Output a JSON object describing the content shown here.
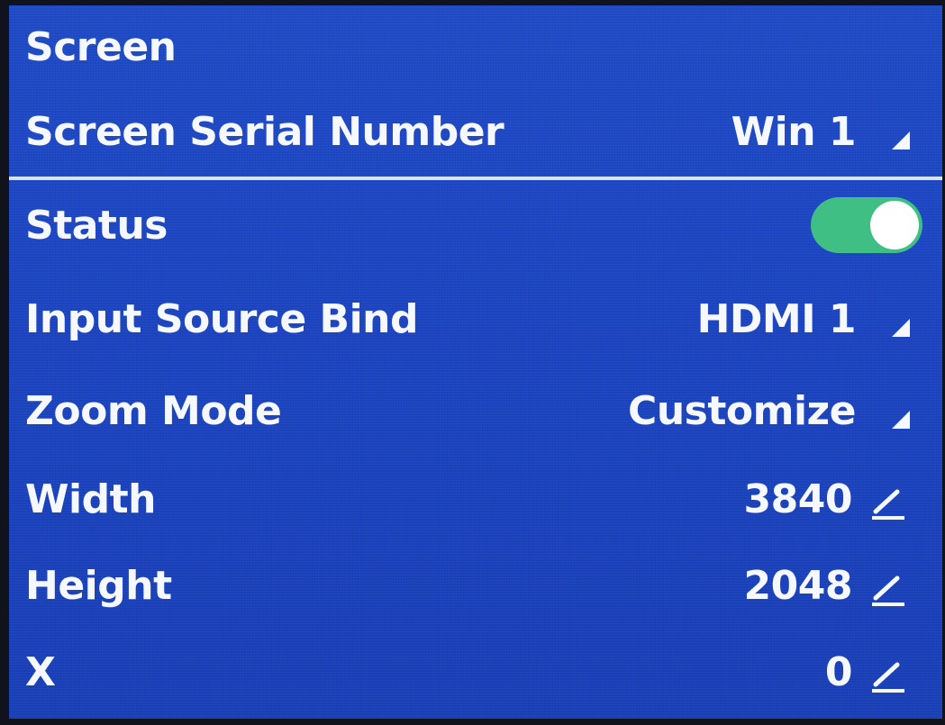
{
  "header": {
    "title": "Screen"
  },
  "rows": {
    "serial": {
      "label": "Screen Serial Number",
      "value": "Win 1",
      "icon": "dropdown-triangle-icon"
    },
    "status": {
      "label": "Status",
      "toggle_on": true,
      "toggle_color": "#3fbf84"
    },
    "input_source": {
      "label": "Input Source Bind",
      "value": "HDMI 1",
      "icon": "dropdown-triangle-icon"
    },
    "zoom_mode": {
      "label": "Zoom Mode",
      "value": "Customize",
      "icon": "dropdown-triangle-icon"
    },
    "width": {
      "label": "Width",
      "value": "3840",
      "icon": "edit-pencil-icon"
    },
    "height": {
      "label": "Height",
      "value": "2048",
      "icon": "edit-pencil-icon"
    },
    "x": {
      "label": "X",
      "value": "0",
      "icon": "edit-pencil-icon"
    }
  },
  "colors": {
    "background": "#1c45c2",
    "text": "#f5f8ff",
    "divider": "#d6e3ff",
    "toggle_on": "#3fbf84"
  }
}
